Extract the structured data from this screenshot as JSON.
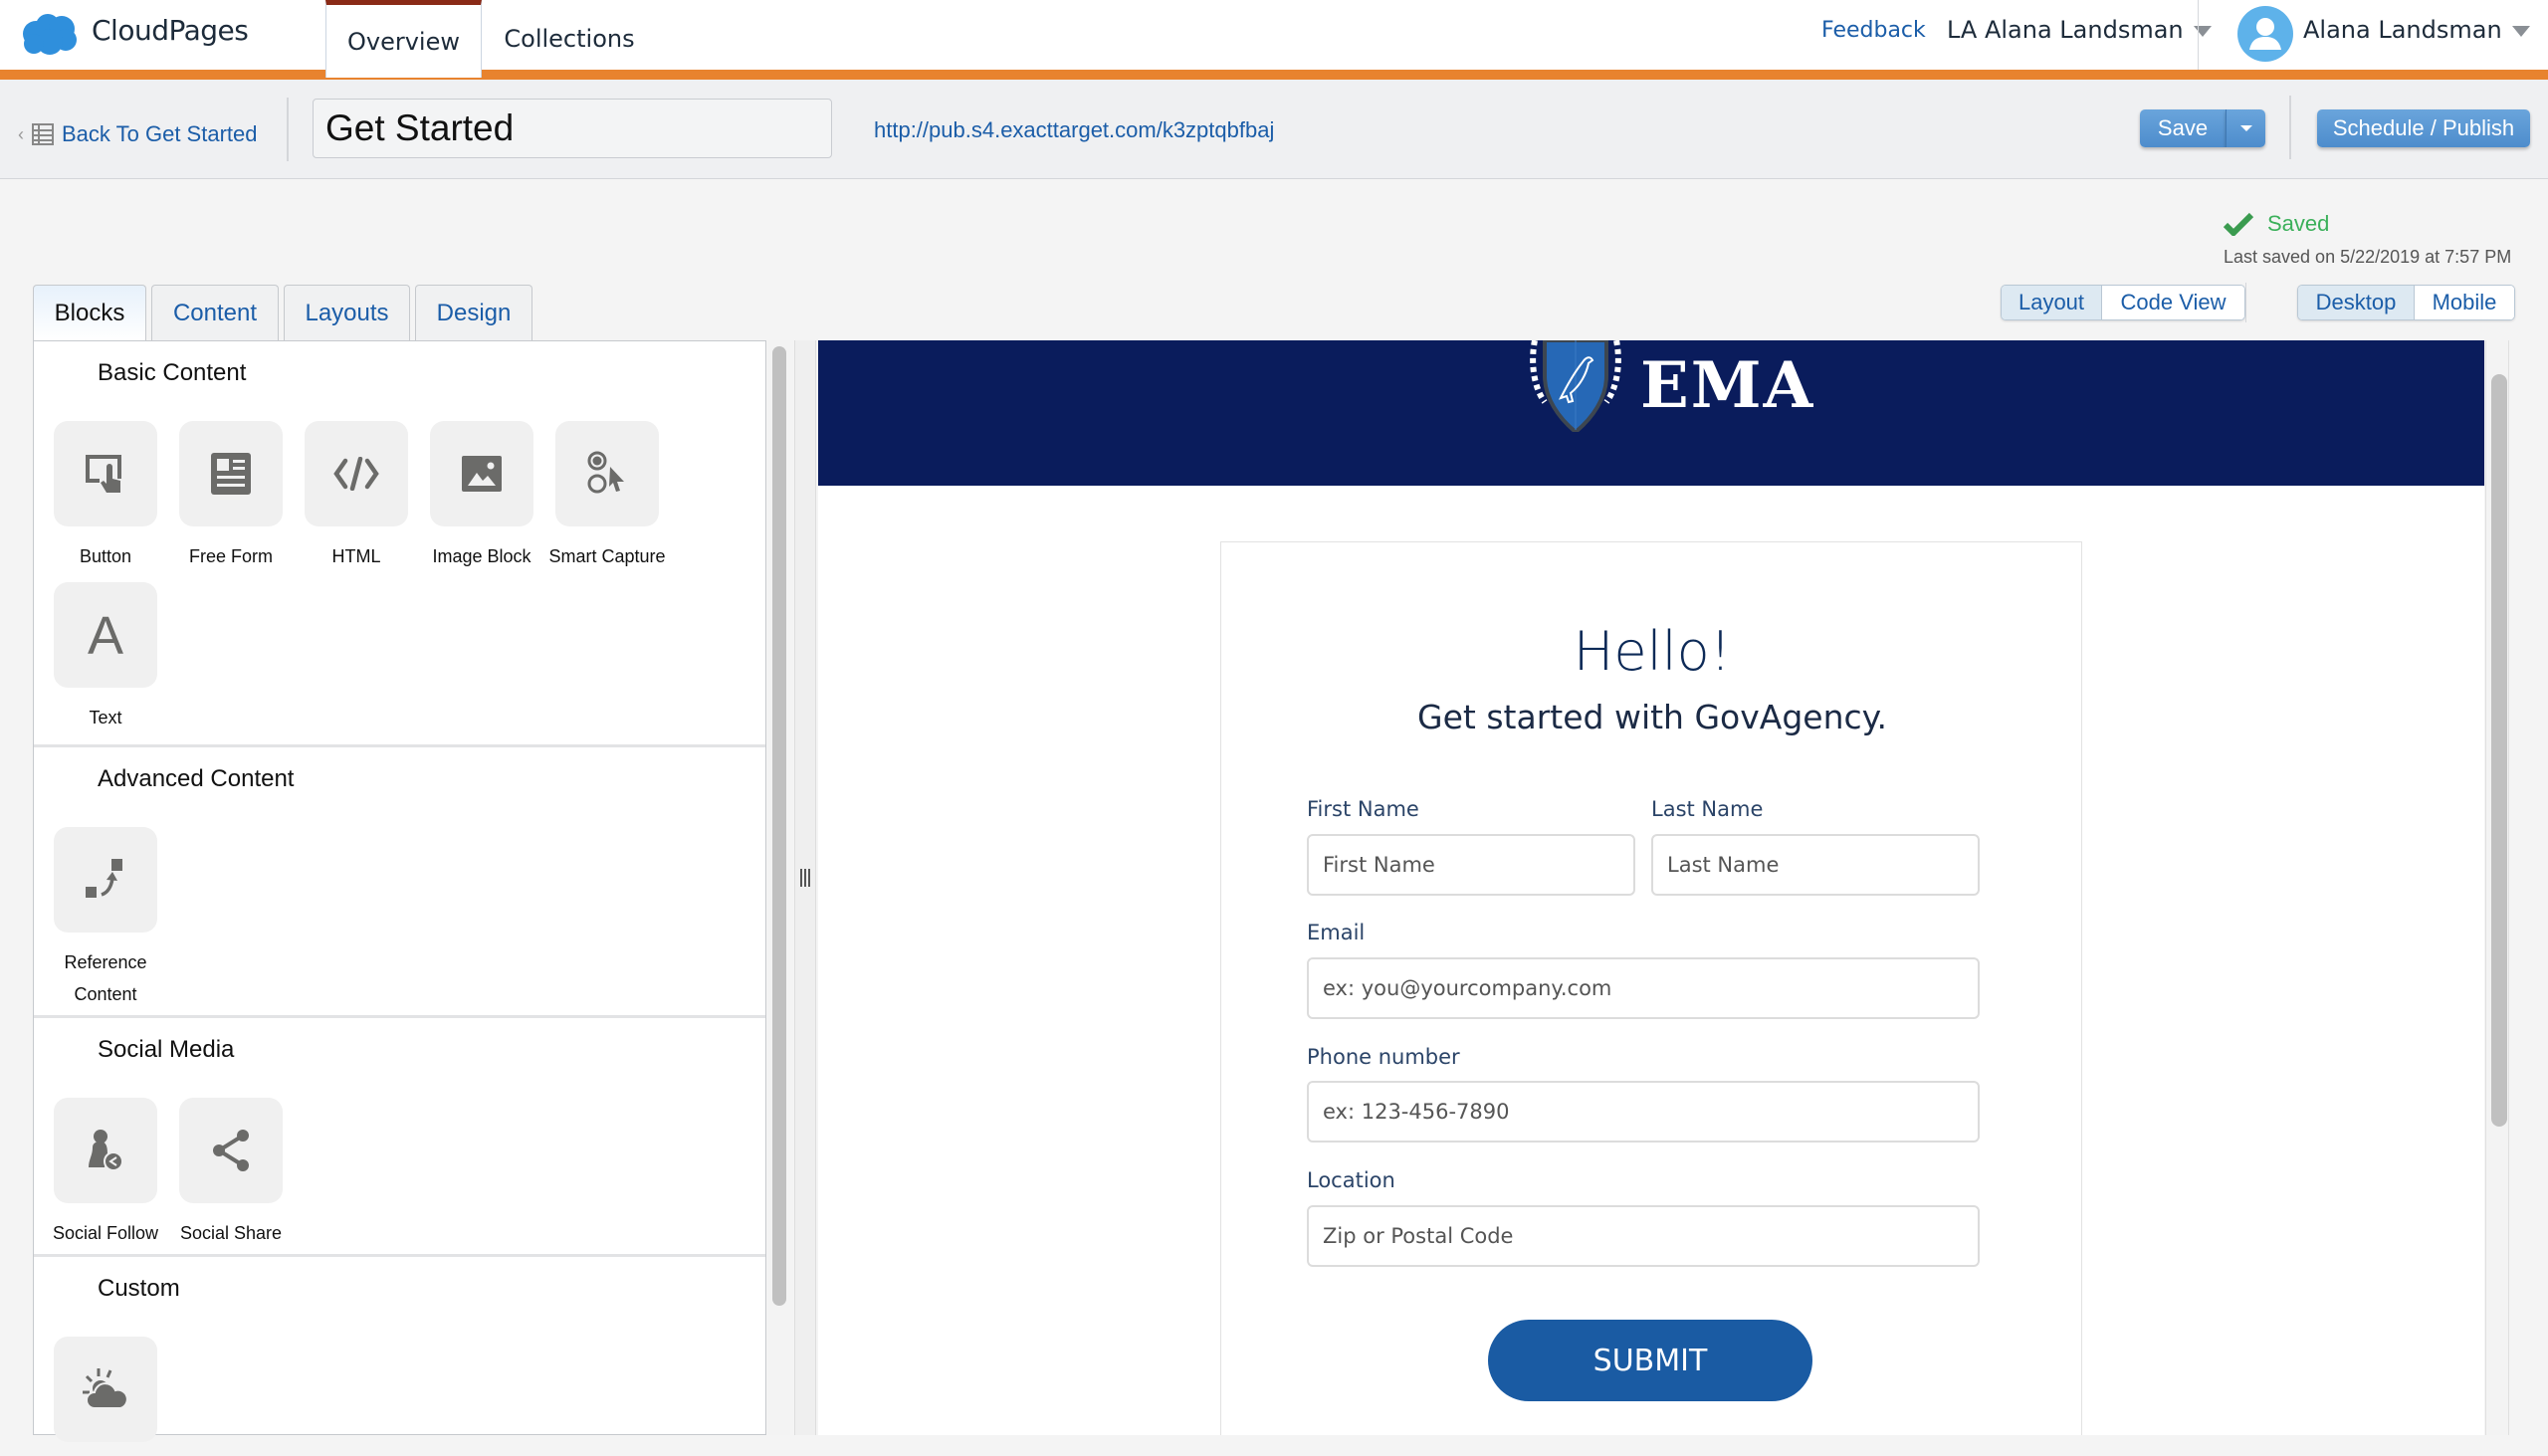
{
  "app": {
    "name": "CloudPages",
    "brand_color": "#e8832e"
  },
  "nav": {
    "tabs": [
      {
        "label": "Overview",
        "active": true
      },
      {
        "label": "Collections",
        "active": false
      }
    ],
    "feedback": "Feedback",
    "account": "LA Alana Landsman",
    "user": "Alana Landsman"
  },
  "toolbar": {
    "back_label": "Back To Get Started",
    "page_title": "Get Started",
    "url": "http://pub.s4.exacttarget.com/k3zptqbfbaj",
    "save_label": "Save",
    "publish_label": "Schedule / Publish"
  },
  "status": {
    "saved_label": "Saved",
    "last_saved": "Last saved on 5/22/2019 at 7:57 PM",
    "saved_color": "#3bb05a"
  },
  "view_toggle": {
    "options": [
      "Layout",
      "Code View"
    ],
    "selected": "Layout"
  },
  "device_toggle": {
    "options": [
      "Desktop",
      "Mobile"
    ],
    "selected": "Desktop"
  },
  "panel": {
    "tabs": [
      {
        "label": "Blocks",
        "active": true
      },
      {
        "label": "Content"
      },
      {
        "label": "Layouts"
      },
      {
        "label": "Design"
      }
    ],
    "sections": [
      {
        "title": "Basic Content",
        "blocks": [
          {
            "label": "Button",
            "icon": "button-touch-icon"
          },
          {
            "label": "Free Form",
            "icon": "free-form-icon"
          },
          {
            "label": "HTML",
            "icon": "code-icon"
          },
          {
            "label": "Image Block",
            "icon": "image-icon"
          },
          {
            "label": "Smart Capture",
            "icon": "smart-capture-icon"
          },
          {
            "label": "Text",
            "icon": "text-icon"
          }
        ]
      },
      {
        "title": "Advanced Content",
        "blocks": [
          {
            "label": "Reference Content",
            "icon": "reference-content-icon"
          }
        ]
      },
      {
        "title": "Social Media",
        "blocks": [
          {
            "label": "Social Follow",
            "icon": "social-follow-icon"
          },
          {
            "label": "Social Share",
            "icon": "share-icon"
          }
        ]
      },
      {
        "title": "Custom",
        "blocks": [
          {
            "label": "",
            "icon": "weather-icon"
          }
        ]
      }
    ]
  },
  "canvas": {
    "banner_text": "EMA",
    "banner_color": "#0a1c5c",
    "heading": "Hello!",
    "subheading": "Get started with GovAgency.",
    "fields": {
      "first_name": {
        "label": "First Name",
        "placeholder": "First Name"
      },
      "last_name": {
        "label": "Last Name",
        "placeholder": "Last Name"
      },
      "email": {
        "label": "Email",
        "placeholder": "ex: you@yourcompany.com"
      },
      "phone": {
        "label": "Phone number",
        "placeholder": "ex: 123-456-7890"
      },
      "location": {
        "label": "Location",
        "placeholder": "Zip or Postal Code"
      }
    },
    "submit_label": "SUBMIT",
    "submit_color": "#1a5ba3"
  }
}
